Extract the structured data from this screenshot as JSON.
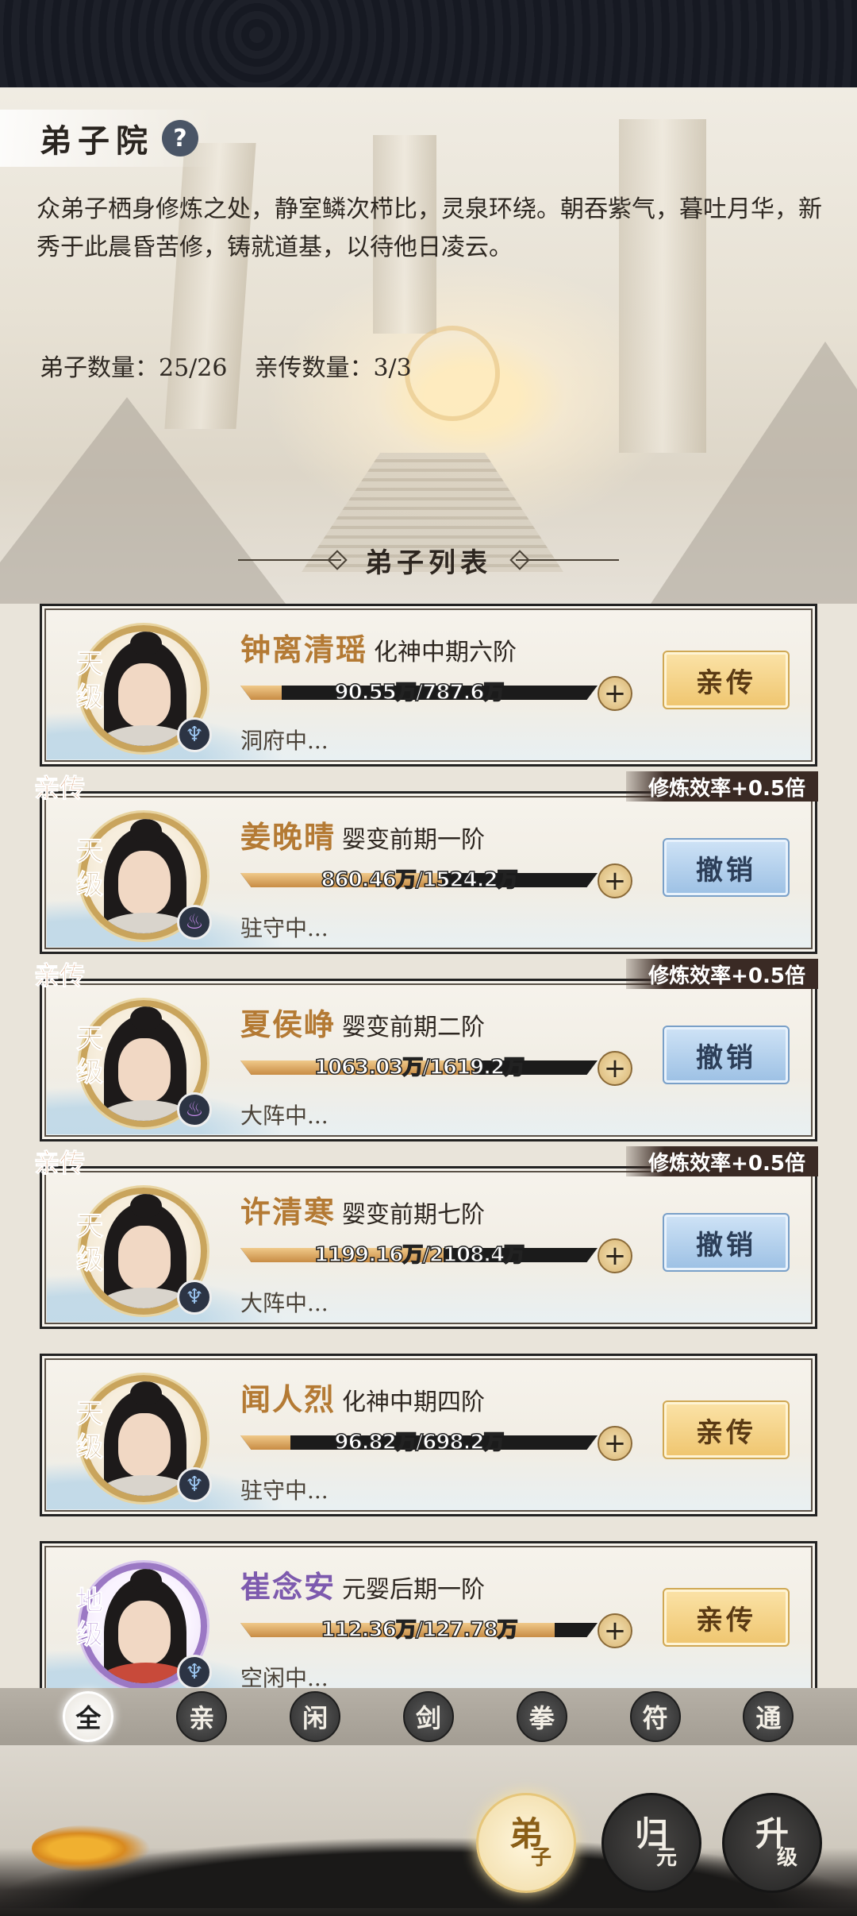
{
  "header": {
    "title": "弟子院",
    "help_icon": "?",
    "description": "众弟子栖身修炼之处，静室鳞次栉比，灵泉环绕。朝吞紫气，暮吐月华，新秀于此晨昏苦修，铸就道基，以待他日凌云。",
    "disciple_count": "弟子数量：25/26",
    "inner_count": "亲传数量：3/3"
  },
  "section_title": "弟子列表",
  "disciples": [
    {
      "name": "钟离清瑶",
      "realm": "化神中期六阶",
      "rank": "天级",
      "progress_text": "90.55万/787.6万",
      "progress": 0.115,
      "status": "洞府中...",
      "action": "亲传",
      "inner": false,
      "bonus": "",
      "element": "water"
    },
    {
      "name": "姜晚晴",
      "realm": "婴变前期一阶",
      "rank": "天级",
      "progress_text": "860.46万/1524.2万",
      "progress": 0.565,
      "status": "驻守中...",
      "action": "撤销",
      "inner": true,
      "tag": "亲传",
      "bonus": "修炼效率+0.5倍",
      "element": "fire"
    },
    {
      "name": "夏侯峥",
      "realm": "婴变前期二阶",
      "rank": "天级",
      "progress_text": "1063.03万/1619.2万",
      "progress": 0.656,
      "status": "大阵中...",
      "action": "撤销",
      "inner": true,
      "tag": "亲传",
      "bonus": "修炼效率+0.5倍",
      "element": "fire"
    },
    {
      "name": "许清寒",
      "realm": "婴变前期七阶",
      "rank": "天级",
      "progress_text": "1199.16万/2108.4万",
      "progress": 0.569,
      "status": "大阵中...",
      "action": "撤销",
      "inner": true,
      "tag": "亲传",
      "bonus": "修炼效率+0.5倍",
      "element": "water"
    },
    {
      "name": "闻人烈",
      "realm": "化神中期四阶",
      "rank": "天级",
      "progress_text": "96.82万/698.2万",
      "progress": 0.139,
      "status": "驻守中...",
      "action": "亲传",
      "inner": false,
      "bonus": "",
      "element": "water"
    },
    {
      "name": "崔念安",
      "realm": "元婴后期一阶",
      "rank": "地级",
      "progress_text": "112.36万/127.78万",
      "progress": 0.879,
      "status": "空闲中...",
      "action": "亲传",
      "inner": false,
      "bonus": "",
      "element": "water"
    }
  ],
  "filters": [
    "全",
    "亲",
    "闲",
    "剑",
    "拳",
    "符",
    "通"
  ],
  "active_filter": 0,
  "bottom_nav": [
    {
      "big": "弟",
      "small": "子",
      "active": true
    },
    {
      "big": "归",
      "small": "元",
      "active": false
    },
    {
      "big": "升",
      "small": "级",
      "active": false
    }
  ],
  "colors": {
    "gold": "#b47a34",
    "purple": "#7d5aae",
    "revoke_blue": "#9cc0e4",
    "accept_gold": "#efc56e"
  }
}
